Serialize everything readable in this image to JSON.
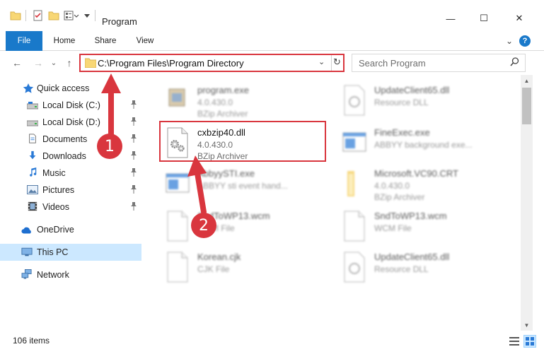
{
  "window": {
    "title": "Program",
    "minimize_glyph": "—",
    "maximize_glyph": "☐",
    "close_glyph": "✕"
  },
  "ribbon": {
    "tabs": [
      "File",
      "Home",
      "Share",
      "View"
    ],
    "help_glyph": "?",
    "expand_glyph": "⌄"
  },
  "nav": {
    "back_glyph": "←",
    "forward_glyph": "→",
    "recent_glyph": "⌄",
    "up_glyph": "↑",
    "address_path": "C:\\Program Files\\Program Directory",
    "dropdown_glyph": "⌄",
    "refresh_glyph": "↻",
    "search_placeholder": "Search Program",
    "search_glyph": "⌕"
  },
  "sidebar": {
    "items": [
      {
        "label": "Quick access",
        "icon": "star-icon"
      },
      {
        "label": "Local Disk (C:)",
        "icon": "drive-icon"
      },
      {
        "label": "Local Disk (D:)",
        "icon": "drive-icon"
      },
      {
        "label": "Documents",
        "icon": "documents-icon"
      },
      {
        "label": "Downloads",
        "icon": "downloads-icon"
      },
      {
        "label": "Music",
        "icon": "music-icon"
      },
      {
        "label": "Pictures",
        "icon": "pictures-icon"
      },
      {
        "label": "Videos",
        "icon": "videos-icon"
      },
      {
        "label": "OneDrive",
        "icon": "onedrive-icon"
      },
      {
        "label": "This PC",
        "icon": "pc-icon"
      },
      {
        "label": "Network",
        "icon": "network-icon"
      }
    ],
    "pin_glyph": "📌"
  },
  "files": [
    {
      "name": "program.exe",
      "version": "4.0.430.0",
      "type": "BZip Archiver",
      "icon": "exe-icon"
    },
    {
      "name": "UpdateClient65.dll",
      "version": "Resource DLL",
      "type": "",
      "icon": "dll-icon"
    },
    {
      "name": "cxbzip40.dll",
      "version": "4.0.430.0",
      "type": "BZip Archiver",
      "icon": "dll-gear-icon"
    },
    {
      "name": "FineExec.exe",
      "version": "ABBYY background exe...",
      "type": "",
      "icon": "app-window-icon"
    },
    {
      "name": "AbbyySTI.exe",
      "version": "ABBYY sti event hand...",
      "type": "",
      "icon": "app-window-icon"
    },
    {
      "name": "Microsoft.VC90.CRT",
      "version": "4.0.430.0",
      "type": "BZip Archiver",
      "icon": "folder-icon"
    },
    {
      "name": "SndToWP13.wcm",
      "version": "WCM File",
      "type": "",
      "icon": "blank-file-icon"
    },
    {
      "name": "SndToWP13.wcm",
      "version": "WCM File",
      "type": "",
      "icon": "blank-file-icon"
    },
    {
      "name": "Korean.cjk",
      "version": "CJK File",
      "type": "",
      "icon": "blank-file-icon"
    },
    {
      "name": "UpdateClient65.dll",
      "version": "Resource DLL",
      "type": "",
      "icon": "dll-icon"
    }
  ],
  "status": {
    "item_count": "106 items"
  },
  "callouts": {
    "step1": "1",
    "step2": "2"
  },
  "colors": {
    "accent": "#1979ca",
    "highlight": "#d9363e",
    "selected_bg": "#cce8ff"
  }
}
